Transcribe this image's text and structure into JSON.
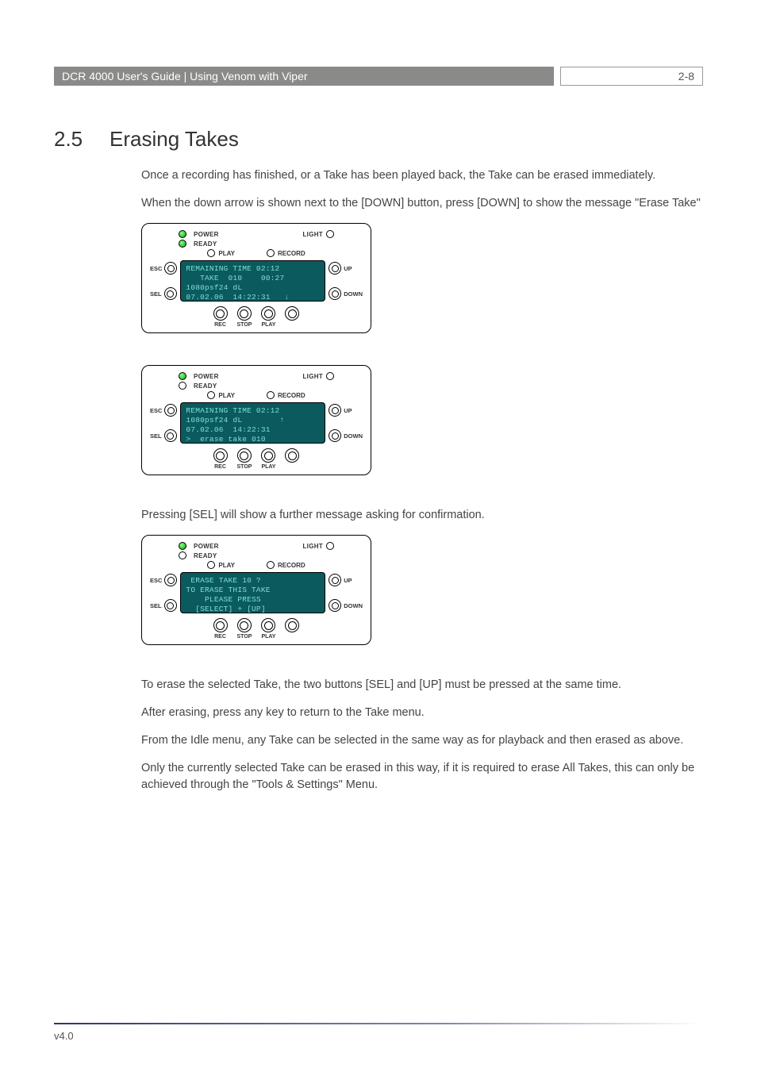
{
  "header": {
    "left": "DCR 4000 User's Guide | Using Venom with Viper",
    "right": "2-8"
  },
  "section": {
    "number": "2.5",
    "title": "Erasing Takes"
  },
  "paragraphs": {
    "p1": "Once a recording has finished, or a Take has been played back, the Take can be erased immediately.",
    "p2": "When the down arrow is shown next to the [DOWN] button, press [DOWN] to show the message \"Erase Take\"",
    "p3": "Pressing [SEL] will show a further message asking for confirmation.",
    "p4": "To erase the selected Take, the two buttons [SEL] and [UP] must be pressed at the same time.",
    "p5": "After erasing, press any key to return to the Take menu.",
    "p6": "From the Idle menu, any Take can be selected in the same way as for playback and then erased as above.",
    "p7": "Only the currently selected Take can be erased in this way, if it is required to erase All Takes, this can only be achieved through the \"Tools & Settings\" Menu."
  },
  "panel_labels": {
    "power": "POWER",
    "light": "LIGHT",
    "ready": "READY",
    "play": "PLAY",
    "record": "RECORD",
    "esc": "ESC",
    "sel": "SEL",
    "up": "UP",
    "down": "DOWN",
    "rec": "REC",
    "stop": "STOP",
    "play_btn": "PLAY"
  },
  "screens": {
    "s1": "REMAINING TIME 02:12\n   TAKE  010    00:27\n1080psf24 dL\n07.02.06  14:22:31   ↓",
    "s2": "REMAINING TIME 02:12\n1080psf24 dL        ↑\n07.02.06  14:22:31\n>  erase take 010",
    "s3": " ERASE TAKE 10 ?\nTO ERASE THIS TAKE\n    PLEASE PRESS\n  [SELECT] + [UP]"
  },
  "panel_state": {
    "p1_ready_on": true,
    "p2_ready_on": false,
    "p3_ready_on": false
  },
  "footer": {
    "version": "v4.0"
  }
}
